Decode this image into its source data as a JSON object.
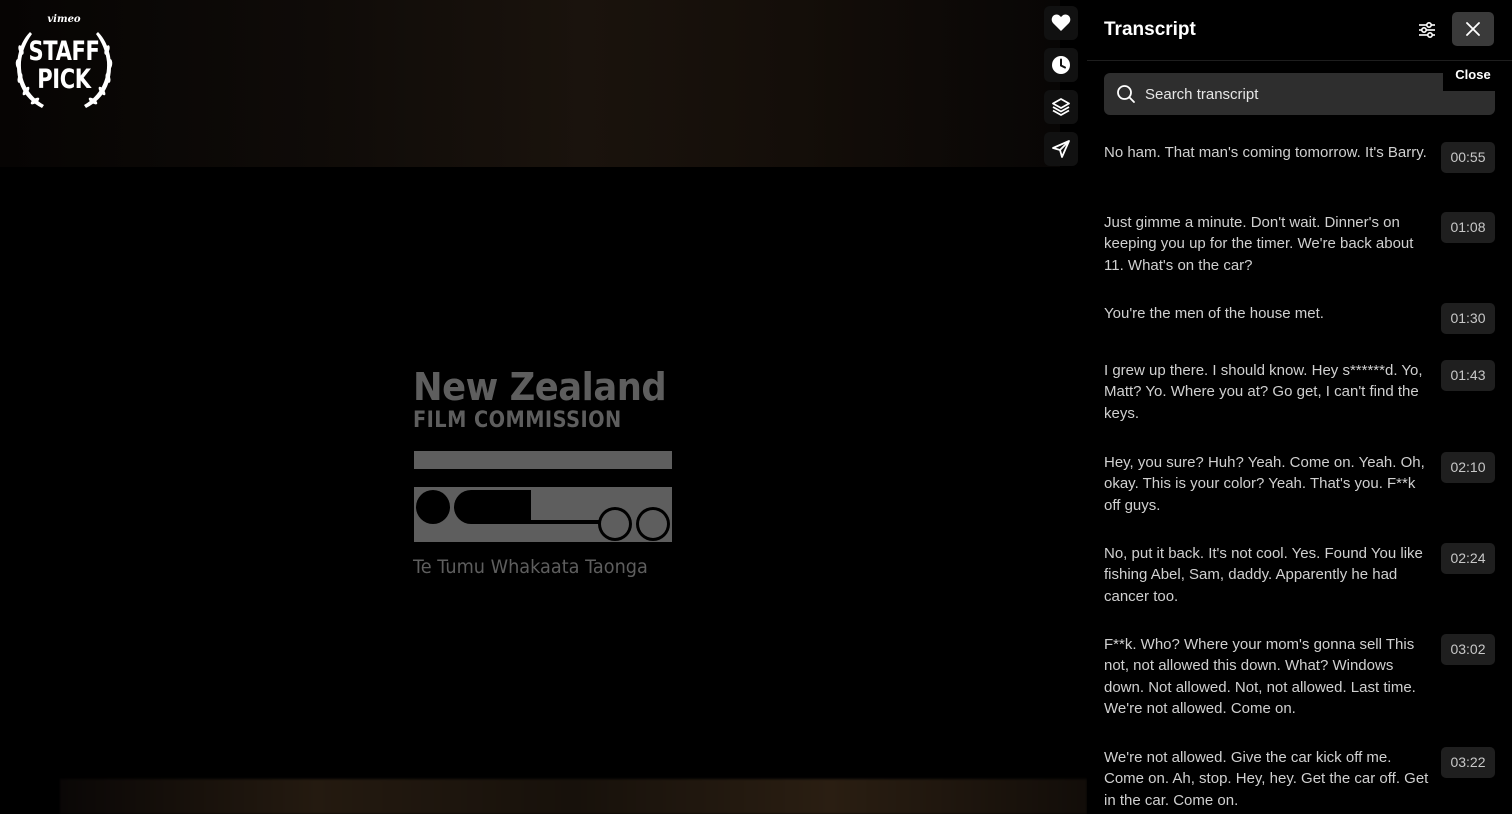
{
  "video": {
    "badge": {
      "brand": "vimeo",
      "line1": "STAFF",
      "line2": "PICK"
    },
    "logo": {
      "title": "New Zealand",
      "subtitle": "FILM COMMISSION",
      "maori": "Te Tumu Whakaata Taonga"
    },
    "side_actions": [
      {
        "name": "like-button",
        "icon": "heart-icon"
      },
      {
        "name": "watch-later-button",
        "icon": "clock-icon"
      },
      {
        "name": "collections-button",
        "icon": "layers-icon"
      },
      {
        "name": "share-button",
        "icon": "paper-plane-icon"
      }
    ]
  },
  "transcript": {
    "title": "Transcript",
    "close_tooltip": "Close",
    "search_placeholder": "Search transcript",
    "entries": [
      {
        "text": "No ham. That man's coming tomorrow. It's Barry.",
        "time": "00:55"
      },
      {
        "text": "Just gimme a minute. Don't wait. Dinner's on keeping you up for the timer. We're back about 11. What's on the car?",
        "time": "01:08"
      },
      {
        "text": "You're the men of the house met.",
        "time": "01:30"
      },
      {
        "text": "I grew up there. I should know. Hey s******d. Yo, Matt? Yo. Where you at? Go get, I can't find the keys.",
        "time": "01:43"
      },
      {
        "text": "Hey, you sure? Huh? Yeah. Come on. Yeah. Oh, okay. This is your color? Yeah. That's you. F**k off guys.",
        "time": "02:10"
      },
      {
        "text": "No, put it back. It's not cool. Yes. Found You like fishing Abel, Sam, daddy. Apparently he had cancer too.",
        "time": "02:24"
      },
      {
        "text": "F**k. Who? Where your mom's gonna sell This not, not allowed this down. What? Windows down. Not allowed. Not, not allowed. Last time. We're not allowed. Come on.",
        "time": "03:02"
      },
      {
        "text": "We're not allowed. Give the car kick off me. Come on. Ah, stop. Hey, hey. Get the car off. Get in the car. Come on.",
        "time": "03:22"
      }
    ]
  }
}
